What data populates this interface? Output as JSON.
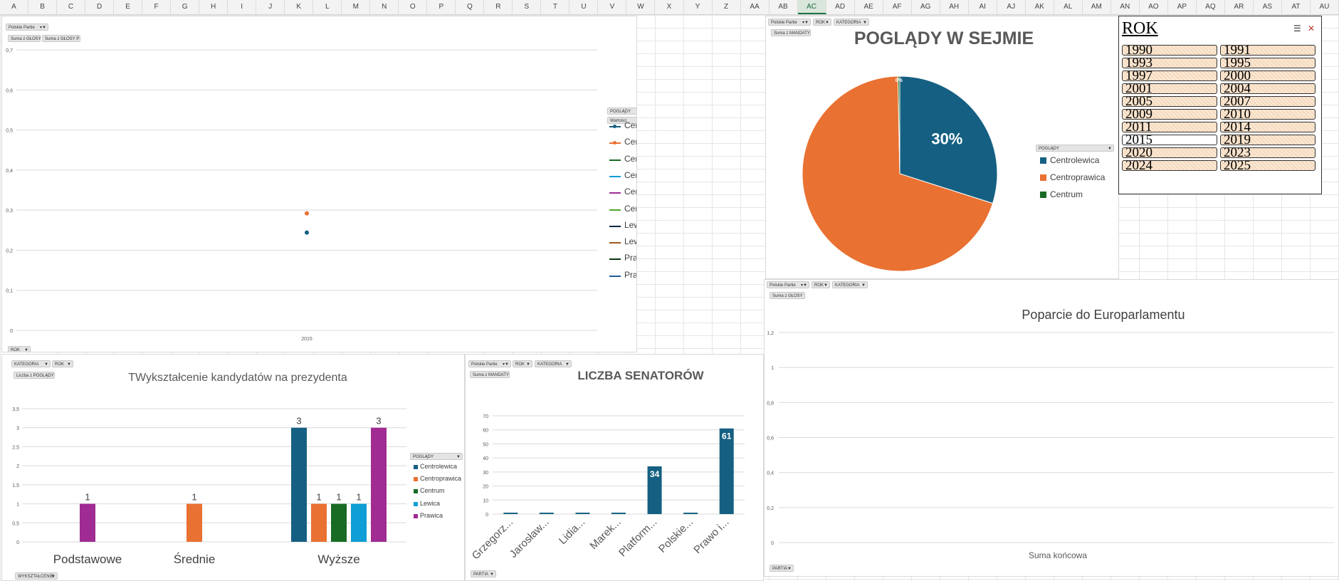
{
  "columns": [
    "A",
    "B",
    "C",
    "D",
    "E",
    "F",
    "G",
    "H",
    "I",
    "J",
    "K",
    "L",
    "M",
    "N",
    "O",
    "P",
    "Q",
    "R",
    "S",
    "T",
    "U",
    "V",
    "W",
    "X",
    "Y",
    "Z",
    "AA",
    "AB",
    "AC",
    "AD",
    "AE",
    "AF",
    "AG",
    "AH",
    "AI",
    "AJ",
    "AK",
    "AL",
    "AM",
    "AN",
    "AO",
    "AP",
    "AQ",
    "AR",
    "AS",
    "AT",
    "AU"
  ],
  "selected_column": "AC",
  "chart_top_left": {
    "filters": {
      "partie": "Polskie Partie",
      "suma1": "Suma z GŁOSY",
      "suma2": "Suma z GŁOSY P",
      "rok": "ROK",
      "poglady": "POGLĄDY",
      "wartosci": "Wartości"
    },
    "chart_data": {
      "type": "scatter",
      "categories": [
        "2015"
      ],
      "yticks": [
        "0",
        "0,1",
        "0,2",
        "0,3",
        "0,4",
        "0,5",
        "0,6",
        "0,7"
      ],
      "ylim": [
        0,
        0.7
      ],
      "series": [
        {
          "name": "Centrolewica - Suma z GLOSY",
          "color": "#156082",
          "values": [
            0.244
          ]
        },
        {
          "name": "Centrolewica - Suma z GŁOSY P",
          "color": "#e97132",
          "values": [
            0.292
          ]
        },
        {
          "name": "Centroprawica - Suma z GLOSY",
          "color": "#196b24",
          "values": []
        },
        {
          "name": "Centroprawica - Suma z GŁOSY P",
          "color": "#0f9ed5",
          "values": []
        },
        {
          "name": "Centrum - Suma z GLOSY",
          "color": "#a02b93",
          "values": []
        },
        {
          "name": "Centrum - Suma z GŁOSY P",
          "color": "#4ea72e",
          "values": []
        },
        {
          "name": "Lewica - Suma z GLOSY",
          "color": "#0e2841",
          "values": []
        },
        {
          "name": "Lewica - Suma z GŁOSY P",
          "color": "#a05a1c",
          "values": []
        },
        {
          "name": "Prawica - Suma z GLOSY",
          "color": "#0d3512",
          "values": []
        },
        {
          "name": "Prawica - Suma z GŁOSY P",
          "color": "#1f5c99",
          "values": []
        }
      ]
    }
  },
  "chart_pie": {
    "filters": {
      "partie": "Polskie Partie",
      "rok": "ROK",
      "kategoria": "KATEGORIA",
      "suma": "Suma z MANDATY",
      "poglady": "POGLĄDY"
    },
    "chart_data": {
      "type": "pie",
      "title": "POGLĄDY W SEJMIE",
      "labels": [
        "Centrolewica",
        "Centroprawica",
        "Centrum"
      ],
      "values": [
        30,
        70,
        0.3
      ],
      "data_labels": [
        "30%",
        "",
        "0%"
      ],
      "colors": [
        "#156082",
        "#e97132",
        "#196b24"
      ]
    }
  },
  "slicer": {
    "title": "ROK",
    "items": [
      {
        "label": "1990",
        "selected": true
      },
      {
        "label": "1991",
        "selected": true
      },
      {
        "label": "1993",
        "selected": true
      },
      {
        "label": "1995",
        "selected": true
      },
      {
        "label": "1997",
        "selected": true
      },
      {
        "label": "2000",
        "selected": true
      },
      {
        "label": "2001",
        "selected": true
      },
      {
        "label": "2004",
        "selected": true
      },
      {
        "label": "2005",
        "selected": true
      },
      {
        "label": "2007",
        "selected": true
      },
      {
        "label": "2009",
        "selected": true
      },
      {
        "label": "2010",
        "selected": true
      },
      {
        "label": "2011",
        "selected": true
      },
      {
        "label": "2014",
        "selected": true
      },
      {
        "label": "2015",
        "selected": false
      },
      {
        "label": "2019",
        "selected": true
      },
      {
        "label": "2020",
        "selected": true
      },
      {
        "label": "2023",
        "selected": true
      },
      {
        "label": "2024",
        "selected": true
      },
      {
        "label": "2025",
        "selected": true
      }
    ]
  },
  "chart_edu": {
    "filters": {
      "kategoria": "KATEGORIA",
      "rok": "ROK",
      "suma": "Liczba z POGLĄDY",
      "poglady": "POGLĄDY",
      "wyksztalcenie": "WYKSZTAŁCENIE"
    },
    "chart_data": {
      "type": "bar",
      "title": "TWykształcenie kandydatów na prezydenta",
      "categories": [
        "Podstawowe",
        "Średnie",
        "Wyższe"
      ],
      "yticks": [
        "0",
        "0,5",
        "1",
        "1,5",
        "2",
        "2,5",
        "3",
        "3,5"
      ],
      "ylim": [
        0,
        3.5
      ],
      "series": [
        {
          "name": "Centrolewica",
          "color": "#156082",
          "values": [
            null,
            null,
            3
          ]
        },
        {
          "name": "Centroprawica",
          "color": "#e97132",
          "values": [
            null,
            1,
            1
          ]
        },
        {
          "name": "Centrum",
          "color": "#196b24",
          "values": [
            null,
            null,
            1
          ]
        },
        {
          "name": "Lewica",
          "color": "#0f9ed5",
          "values": [
            null,
            null,
            1
          ]
        },
        {
          "name": "Prawica",
          "color": "#a02b93",
          "values": [
            1,
            null,
            3
          ]
        }
      ]
    }
  },
  "chart_senat": {
    "filters": {
      "partie": "Polskie Partie",
      "rok": "ROK",
      "kategoria": "KATEGORIA",
      "suma": "Suma z MANDATY",
      "partia": "PARTIA"
    },
    "chart_data": {
      "type": "bar",
      "title": "LICZBA SENATORÓW",
      "categories": [
        "Grzegorz...",
        "Jarosław...",
        "Lidia...",
        "Marek...",
        "Platform...",
        "Polskie...",
        "Prawo i..."
      ],
      "values": [
        1,
        1,
        1,
        1,
        34,
        1,
        61
      ],
      "data_labels": [
        "",
        "",
        "",
        "",
        "34",
        "",
        "61"
      ],
      "yticks": [
        "0",
        "10",
        "20",
        "30",
        "40",
        "50",
        "60",
        "70"
      ],
      "ylim": [
        0,
        70
      ],
      "color": "#156082"
    }
  },
  "chart_euro": {
    "filters": {
      "partie": "Polskie Partie",
      "rok": "ROK",
      "kategoria": "KATEGORIA",
      "suma": "Suma z GŁOSY",
      "partia": "PARTIA"
    },
    "chart_data": {
      "type": "bar",
      "title": "Poparcie do Europarlamentu",
      "categories": [
        "Suma końcowa"
      ],
      "values": [],
      "yticks": [
        "0",
        "0,2",
        "0,4",
        "0,6",
        "0,8",
        "1",
        "1,2"
      ],
      "ylim": [
        0,
        1.2
      ]
    }
  }
}
